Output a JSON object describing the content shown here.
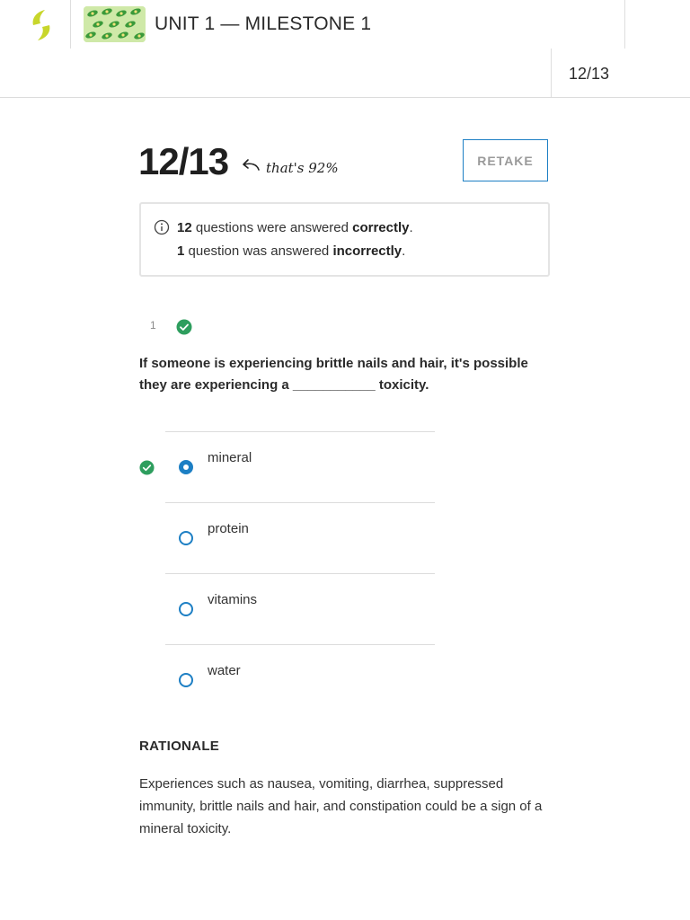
{
  "header": {
    "unit_title": "UNIT 1 — MILESTONE 1",
    "score": "12/13",
    "brand_color": "#c8d62b"
  },
  "score": {
    "big": "12/13",
    "note": "that's 92%",
    "retake_label": "RETAKE"
  },
  "summary": {
    "correct_count": "12",
    "correct_text": " questions were answered ",
    "correct_word": "correctly",
    "incorrect_count": "1",
    "incorrect_text": " question was answered ",
    "incorrect_word": "incorrectly",
    "period": "."
  },
  "question": {
    "number": "1",
    "status": "correct",
    "text": "If someone is experiencing brittle nails and hair, it's possible they are experiencing a ___________ toxicity.",
    "choices": [
      {
        "label": "mineral",
        "selected": true,
        "correct": true
      },
      {
        "label": "protein",
        "selected": false,
        "correct": false
      },
      {
        "label": "vitamins",
        "selected": false,
        "correct": false
      },
      {
        "label": "water",
        "selected": false,
        "correct": false
      }
    ]
  },
  "rationale": {
    "title": "RATIONALE",
    "text": "Experiences such as nausea, vomiting, diarrhea, suppressed immunity, brittle nails and hair, and constipation could be a sign of a mineral toxicity."
  },
  "colors": {
    "accent_blue": "#1d7fc4",
    "correct_green": "#2e9e5e"
  }
}
